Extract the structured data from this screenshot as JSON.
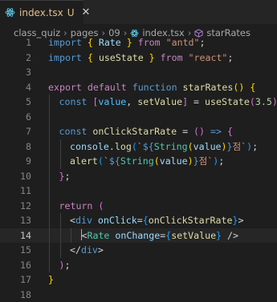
{
  "tab": {
    "filename": "index.tsx",
    "modified": "U",
    "close": "✕"
  },
  "breadcrumb": [
    "class_quiz",
    "pages",
    "09",
    "index.tsx",
    "starRates"
  ],
  "editor": {
    "active_line": 14,
    "lines": [
      {
        "n": "1",
        "indent": 0,
        "tokens": [
          [
            "kw",
            "import "
          ],
          [
            "b1",
            "{ "
          ],
          [
            "var",
            "Rate"
          ],
          [
            "b1",
            " }"
          ],
          [
            "ctl",
            " from "
          ],
          [
            "str",
            "\"antd\""
          ],
          [
            "pun",
            ";"
          ]
        ]
      },
      {
        "n": "2",
        "indent": 0,
        "tokens": [
          [
            "kw",
            "import "
          ],
          [
            "b1",
            "{ "
          ],
          [
            "fn",
            "useState"
          ],
          [
            "b1",
            " }"
          ],
          [
            "ctl",
            " from "
          ],
          [
            "str",
            "\"react\""
          ],
          [
            "pun",
            ";"
          ]
        ]
      },
      {
        "n": "3",
        "indent": 0,
        "tokens": []
      },
      {
        "n": "4",
        "indent": 0,
        "tokens": [
          [
            "ctl",
            "export "
          ],
          [
            "ctl",
            "default "
          ],
          [
            "kw",
            "function "
          ],
          [
            "fn",
            "starRates"
          ],
          [
            "b1",
            "() {"
          ]
        ]
      },
      {
        "n": "5",
        "indent": 1,
        "tokens": [
          [
            "kw",
            "const "
          ],
          [
            "b2",
            "["
          ],
          [
            "cst",
            "value"
          ],
          [
            "pun",
            ", "
          ],
          [
            "fn",
            "setValue"
          ],
          [
            "b2",
            "]"
          ],
          [
            "pun",
            " = "
          ],
          [
            "fn",
            "useState"
          ],
          [
            "b2",
            "("
          ],
          [
            "num",
            "3.5"
          ],
          [
            "b2",
            ")"
          ],
          [
            "pun",
            ";"
          ]
        ]
      },
      {
        "n": "6",
        "indent": 1,
        "tokens": []
      },
      {
        "n": "7",
        "indent": 1,
        "tokens": [
          [
            "kw",
            "const "
          ],
          [
            "fn",
            "onClickStarRate"
          ],
          [
            "pun",
            " = "
          ],
          [
            "b2",
            "()"
          ],
          [
            "kw",
            " => "
          ],
          [
            "b2",
            "{"
          ]
        ]
      },
      {
        "n": "8",
        "indent": 2,
        "tokens": [
          [
            "var",
            "console"
          ],
          [
            "pun",
            "."
          ],
          [
            "fn",
            "log"
          ],
          [
            "b3",
            "("
          ],
          [
            "str",
            "`"
          ],
          [
            "tpl",
            "${"
          ],
          [
            "typ",
            "String"
          ],
          [
            "b1",
            "("
          ],
          [
            "var",
            "value"
          ],
          [
            "b1",
            ")"
          ],
          [
            "tpl",
            "}"
          ],
          [
            "str",
            "점`"
          ],
          [
            "b3",
            ")"
          ],
          [
            "pun",
            ";"
          ]
        ]
      },
      {
        "n": "9",
        "indent": 2,
        "tokens": [
          [
            "fn",
            "alert"
          ],
          [
            "b3",
            "("
          ],
          [
            "str",
            "`"
          ],
          [
            "tpl",
            "${"
          ],
          [
            "typ",
            "String"
          ],
          [
            "b1",
            "("
          ],
          [
            "var",
            "value"
          ],
          [
            "b1",
            ")"
          ],
          [
            "tpl",
            "}"
          ],
          [
            "str",
            "점`"
          ],
          [
            "b3",
            ")"
          ],
          [
            "pun",
            ";"
          ]
        ]
      },
      {
        "n": "10",
        "indent": 1,
        "tokens": [
          [
            "b2",
            "}"
          ],
          [
            "pun",
            ";"
          ]
        ]
      },
      {
        "n": "11",
        "indent": 1,
        "tokens": []
      },
      {
        "n": "12",
        "indent": 1,
        "tokens": [
          [
            "ctl",
            "return "
          ],
          [
            "b2",
            "("
          ]
        ]
      },
      {
        "n": "13",
        "indent": 2,
        "tokens": [
          [
            "pun",
            "<"
          ],
          [
            "tag",
            "div "
          ],
          [
            "var",
            "onClick"
          ],
          [
            "pun",
            "="
          ],
          [
            "b3",
            "{"
          ],
          [
            "fn",
            "onClickStarRate"
          ],
          [
            "b3",
            "}"
          ],
          [
            "pun",
            ">"
          ]
        ]
      },
      {
        "n": "14",
        "indent": 3,
        "tokens": [
          [
            "pun",
            "<"
          ],
          [
            "typ",
            "Rate "
          ],
          [
            "var",
            "onChange"
          ],
          [
            "pun",
            "="
          ],
          [
            "b3",
            "{"
          ],
          [
            "fn",
            "setValue"
          ],
          [
            "b3",
            "}"
          ],
          [
            "pun",
            " />"
          ]
        ]
      },
      {
        "n": "15",
        "indent": 2,
        "tokens": [
          [
            "pun",
            "</"
          ],
          [
            "tag",
            "div"
          ],
          [
            "pun",
            ">"
          ]
        ]
      },
      {
        "n": "16",
        "indent": 1,
        "tokens": [
          [
            "b2",
            ")"
          ],
          [
            "pun",
            ";"
          ]
        ]
      },
      {
        "n": "17",
        "indent": 0,
        "tokens": [
          [
            "b1",
            "}"
          ]
        ]
      },
      {
        "n": "18",
        "indent": 0,
        "tokens": []
      }
    ]
  }
}
